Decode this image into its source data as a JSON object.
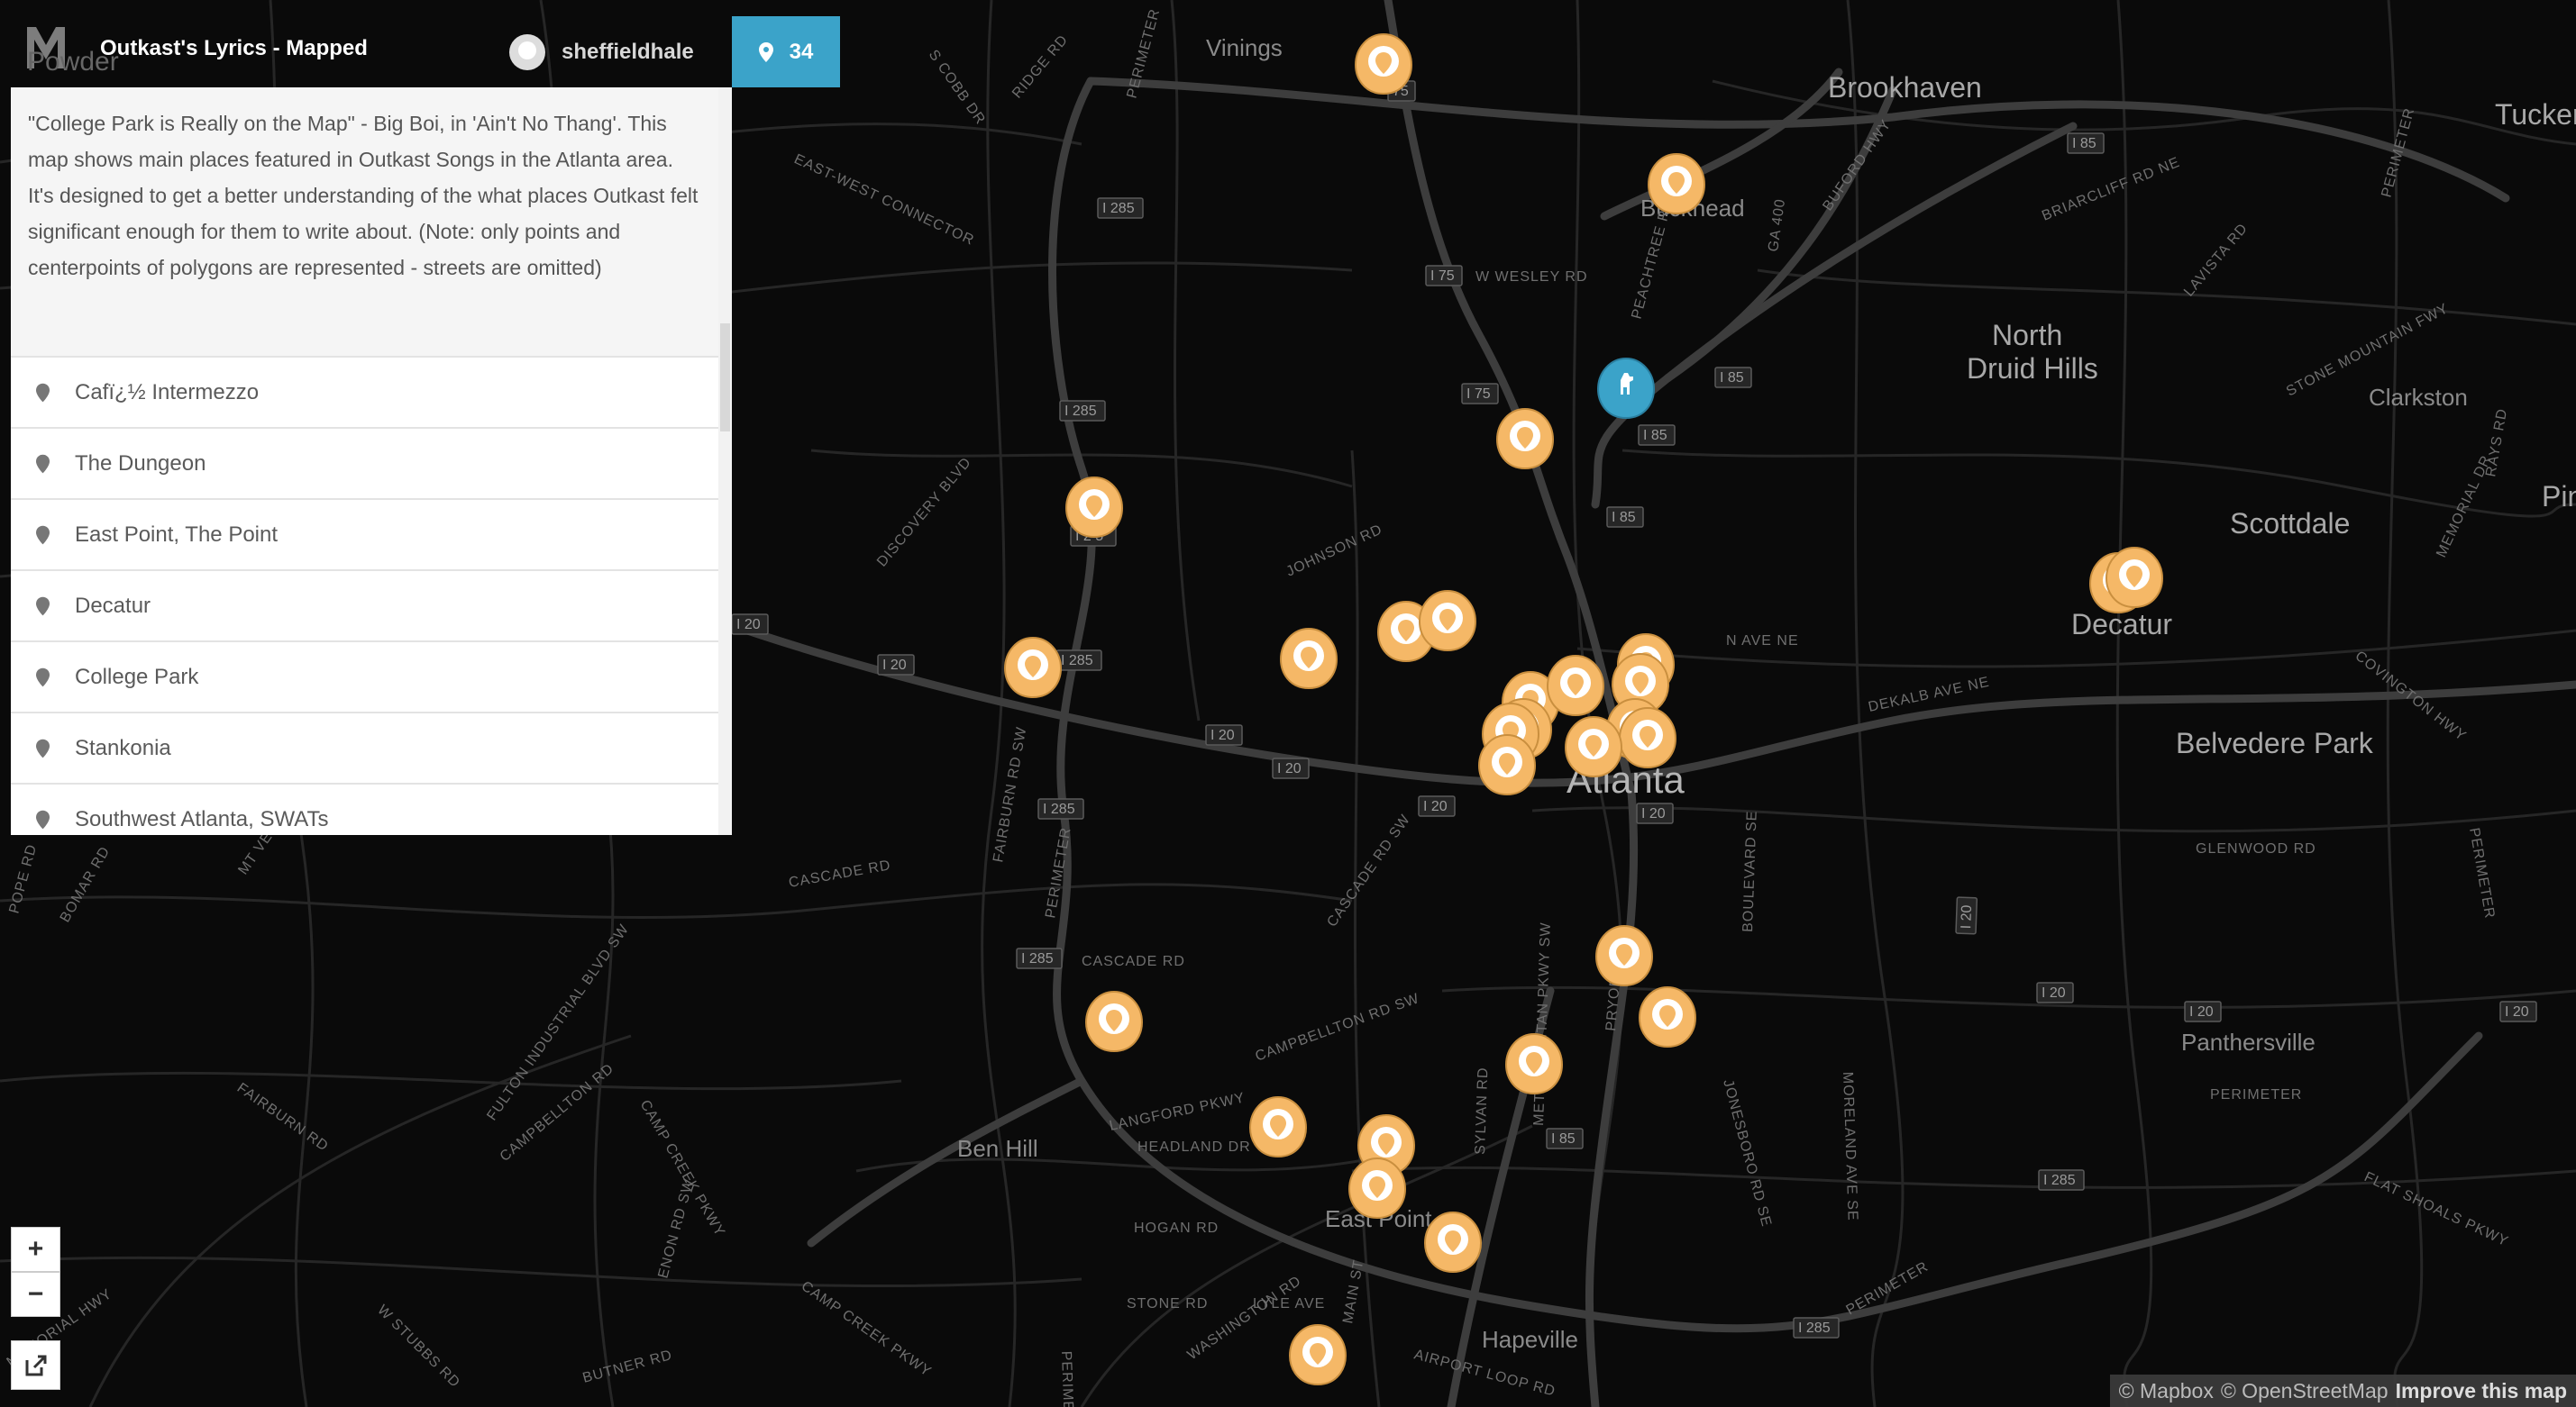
{
  "header": {
    "logo_letter": "M",
    "logo_caption": "Powder",
    "title": "Outkast's Lyrics - Mapped",
    "username": "sheffieldhale",
    "marker_count": "34"
  },
  "sidebar": {
    "description": "\"College Park is Really on the Map\" - Big Boi, in 'Ain't No Thang'. This map shows main places featured in Outkast Songs in the Atlanta area. It's designed to get a better understanding of the what places Outkast felt significant enough for them to write about. (Note: only points and centerpoints of polygons are represented - streets are omitted)",
    "items": [
      {
        "label": "Cafï¿½ Intermezzo"
      },
      {
        "label": "The Dungeon"
      },
      {
        "label": "East Point, The Point"
      },
      {
        "label": "Decatur"
      },
      {
        "label": "College Park"
      },
      {
        "label": "Stankonia"
      },
      {
        "label": "Southwest Atlanta, SWATs"
      }
    ]
  },
  "controls": {
    "zoom_in": "+",
    "zoom_out": "−"
  },
  "attribution": {
    "mapbox": "© Mapbox",
    "osm": "© OpenStreetMap",
    "improve": "Improve this map"
  },
  "map": {
    "colors": {
      "background": "#0a0a0a",
      "road": "#2e2e2e",
      "highway": "#3d3d3d",
      "marker": "#f5b867",
      "marker_selected": "#3ba3c9",
      "accent": "#3ba3c9"
    },
    "place_labels": {
      "vinings": "Vinings",
      "brookhaven": "Brookhaven",
      "tucker": "Tucker",
      "buckhead": "Buckhead",
      "north_druid_1": "North",
      "north_druid_2": "Druid Hills",
      "clarkston": "Clarkston",
      "scottdale": "Scottdale",
      "pine": "Pin",
      "decatur": "Decatur",
      "belvedere": "Belvedere Park",
      "atlanta": "Atlanta",
      "panthersville": "Panthersville",
      "ben_hill": "Ben Hill",
      "east_point": "East Point",
      "hapeville": "Hapeville"
    },
    "road_labels": {
      "s_cobb": "S COBB DR",
      "ridge": "RIDGE RD",
      "perimeter_n": "PERIMETER",
      "east_west": "EAST-WEST CONNECTOR",
      "w_wesley": "W WESLEY RD",
      "peachtree": "PEACHTREE RD",
      "ga400": "GA 400",
      "buford": "BUFORD HWY",
      "briarcliff": "BRIARCLIFF RD NE",
      "lavista": "LAVISTA RD",
      "stone_mtn": "STONE MOUNTAIN FWY",
      "perimeter_ne": "PERIMETER",
      "memorial": "MEMORIAL DR",
      "rays": "RAYS RD",
      "discovery": "DISCOVERY BLVD",
      "johnson": "JOHNSON RD",
      "n_ave": "N AVE NE",
      "dekalb": "DEKALB AVE NE",
      "covington": "COVINGTON HWY",
      "perimeter_e": "PERIMETER",
      "glenwood": "GLENWOOD RD",
      "fairburn": "FAIRBURN RD SW",
      "perimeter_w": "PERIMETER",
      "cascade": "CASCADE RD",
      "cascade_rd": "CASCADE RD",
      "cascade_sw": "CASCADE RD SW",
      "campbellton_sw": "CAMPBELLTON RD SW",
      "boulevard": "BOULEVARD SE",
      "moreland": "MORELAND AVE SE",
      "metropolitan": "METROPOLITAN PKWY SW",
      "pryor": "PRYOR RD",
      "jonesboro": "JONESBORO RD SE",
      "flat_shoals": "FLAT SHOALS PKWY",
      "perimeter_se": "PERIMETER",
      "perimeter_se2": "PERIMETER",
      "fulton": "FULTON INDUSTRIAL BLVD SW",
      "fairburn_rd": "FAIRBURN RD",
      "campbellton": "CAMPBELLTON RD",
      "camp_creek": "CAMP CREEK PKWY",
      "enon": "ENON RD SW",
      "langford": "LANGFORD PKWY",
      "headland": "HEADLAND DR",
      "sylvan": "SYLVAN RD",
      "hogan": "HOGAN RD",
      "stone_rd": "STONE RD",
      "washington": "WASHINGTON RD",
      "lyle": "LYLE AVE",
      "main": "MAIN ST",
      "airport_loop": "AIRPORT LOOP RD",
      "camp_creek2": "CAMP CREEK PKWY",
      "w_stubbs": "W STUBBS RD",
      "butner": "BUTNER RD",
      "memorial_hwy": "MEMORIAL HWY",
      "pope": "POPE RD",
      "bomar": "BOMAR RD",
      "mt_vernon": "MT VE",
      "perimeter_s": "PERIMETER"
    },
    "shields": {
      "i75_n": "75",
      "i285_nw": "I 285",
      "i75_wesley": "I 75",
      "i85_ne": "I 85",
      "i85_n": "I 85",
      "i75_mid": "I 75",
      "i85_mid": "I 85",
      "i85_center": "I 85",
      "i285_w1": "I 285",
      "i285_w2": "I 2 5",
      "i20_w": "I 20",
      "i20_w2": "I 20",
      "i285_w3": "I 285",
      "i20_c1": "I 20",
      "i20_c2": "I 20",
      "i20_c3": "I 20",
      "i285_sw": "I 285",
      "i285_sw2": "I 285",
      "i20_e": "I 20",
      "i20_e2": "I 20",
      "i20_e3": "I 20",
      "i20_down": "I 20",
      "i285_e": "I 285",
      "i285_se": "I 285",
      "i85_s": "I 85",
      "i20_atl": "I 20"
    }
  }
}
